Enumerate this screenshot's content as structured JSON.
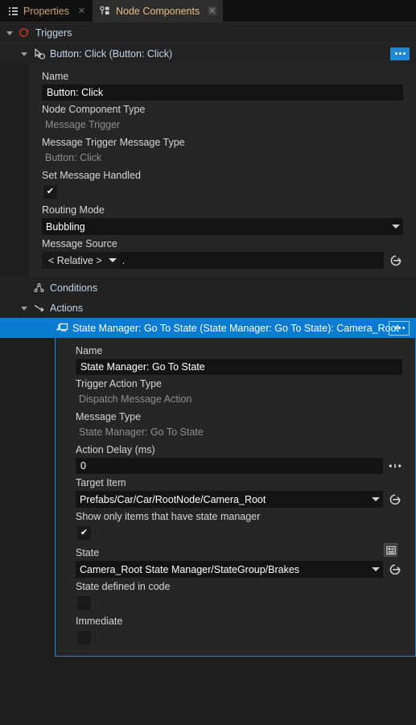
{
  "tabs": [
    {
      "label": "Properties",
      "icon": "list-icon",
      "active": false,
      "close": "✕"
    },
    {
      "label": "Node Components",
      "icon": "node-components-icon",
      "active": true,
      "close": "✕"
    }
  ],
  "tree": {
    "triggers_label": "Triggers",
    "trigger_item_label": "Button: Click (Button: Click)",
    "conditions_label": "Conditions",
    "actions_label": "Actions",
    "action_item_label": "State Manager: Go To State (State Manager: Go To State): Camera_Root"
  },
  "trigger_properties": {
    "name_label": "Name",
    "name_value": "Button: Click",
    "node_component_type_label": "Node Component Type",
    "node_component_type_value": "Message Trigger",
    "message_trigger_message_type_label": "Message Trigger Message Type",
    "message_trigger_message_type_value": "Button: Click",
    "set_message_handled_label": "Set Message Handled",
    "set_message_handled_checked": "✔",
    "routing_mode_label": "Routing Mode",
    "routing_mode_value": "Bubbling",
    "message_source_label": "Message Source",
    "message_source_scope": "< Relative >",
    "message_source_path": "."
  },
  "action_properties": {
    "name_label": "Name",
    "name_value": "State Manager: Go To State",
    "trigger_action_type_label": "Trigger Action Type",
    "trigger_action_type_value": "Dispatch Message Action",
    "message_type_label": "Message Type",
    "message_type_value": "State Manager: Go To State",
    "action_delay_label": "Action Delay (ms)",
    "action_delay_value": "0",
    "target_item_label": "Target Item",
    "target_item_value": "Prefabs/Car/Car/RootNode/Camera_Root",
    "show_only_state_manager_label": "Show only items that have state manager",
    "show_only_state_manager_checked": "✔",
    "state_label": "State",
    "state_value": "Camera_Root State Manager/StateGroup/Brakes",
    "state_defined_in_code_label": "State defined in code",
    "state_defined_in_code_checked": "",
    "immediate_label": "Immediate",
    "immediate_checked": ""
  },
  "colors": {
    "accent": "#1e8ad6",
    "selection": "#0a7cd0",
    "tab_text": "#c9a277",
    "panel_bg": "#262626",
    "window_bg": "#1e1e1e"
  }
}
